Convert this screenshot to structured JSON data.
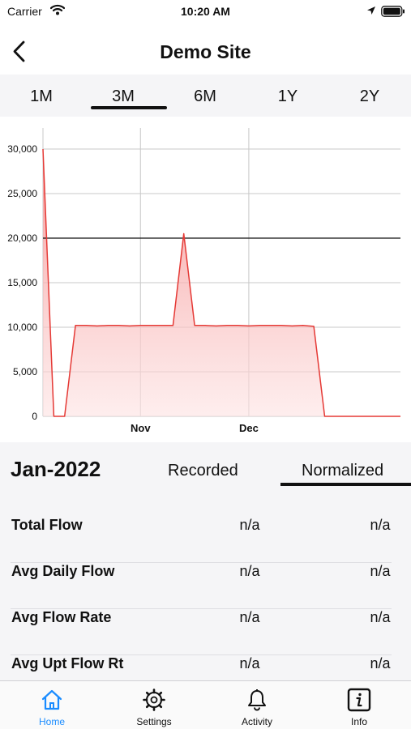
{
  "status_bar": {
    "carrier": "Carrier",
    "time": "10:20 AM"
  },
  "nav": {
    "title": "Demo Site",
    "back_icon": "chevron-left-icon"
  },
  "range_tabs": [
    {
      "label": "1M",
      "selected": false
    },
    {
      "label": "3M",
      "selected": true
    },
    {
      "label": "6M",
      "selected": false
    },
    {
      "label": "1Y",
      "selected": false
    },
    {
      "label": "2Y",
      "selected": false
    }
  ],
  "chart_data": {
    "type": "area",
    "title": "",
    "xlabel": "",
    "ylabel": "",
    "ylim": [
      0,
      30000
    ],
    "yticks": [
      "0",
      "5,000",
      "10,000",
      "15,000",
      "20,000",
      "25,000",
      "30,000"
    ],
    "ytick_values": [
      0,
      5000,
      10000,
      15000,
      20000,
      25000,
      30000
    ],
    "xticks": [
      "Nov",
      "Dec"
    ],
    "reference_line": 20000,
    "line_color": "#e53935",
    "fill_color": "#f7a8a8",
    "series": [
      {
        "values": [
          30000,
          0,
          0,
          10200,
          10200,
          10150,
          10200,
          10200,
          10150,
          10200,
          10200,
          10200,
          10200,
          20500,
          10200,
          10200,
          10150,
          10200,
          10200,
          10150,
          10200,
          10200,
          10200,
          10150,
          10200,
          10100,
          0,
          0,
          0,
          0,
          0,
          0,
          0,
          0
        ]
      }
    ]
  },
  "summary": {
    "period": "Jan-2022",
    "tabs": [
      {
        "label": "Recorded",
        "selected": false
      },
      {
        "label": "Normalized",
        "selected": true
      }
    ],
    "rows": [
      {
        "label": "Total Flow",
        "recorded": "n/a",
        "normalized": "n/a"
      },
      {
        "label": "Avg Daily Flow",
        "recorded": "n/a",
        "normalized": "n/a"
      },
      {
        "label": "Avg Flow Rate",
        "recorded": "n/a",
        "normalized": "n/a"
      },
      {
        "label": "Avg Upt Flow Rt",
        "recorded": "n/a",
        "normalized": "n/a"
      }
    ]
  },
  "tabbar": [
    {
      "label": "Home",
      "icon": "home-icon",
      "active": true
    },
    {
      "label": "Settings",
      "icon": "gear-icon",
      "active": false
    },
    {
      "label": "Activity",
      "icon": "bell-icon",
      "active": false
    },
    {
      "label": "Info",
      "icon": "info-icon",
      "active": false
    }
  ],
  "colors": {
    "accent": "#1a8cff",
    "chart_line": "#e53935"
  }
}
